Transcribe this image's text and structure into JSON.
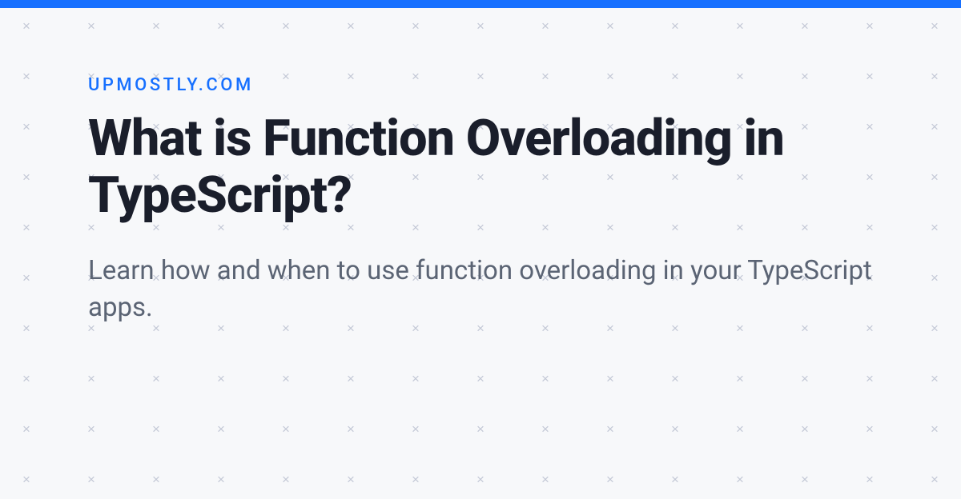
{
  "site_label": "UPMOSTLY.COM",
  "heading": "What is Function Overloading in TypeScript?",
  "subtitle": "Learn how and when to use function overloading in your TypeScript apps.",
  "pattern": {
    "cols": 15,
    "rows": 10,
    "symbol": "×"
  }
}
